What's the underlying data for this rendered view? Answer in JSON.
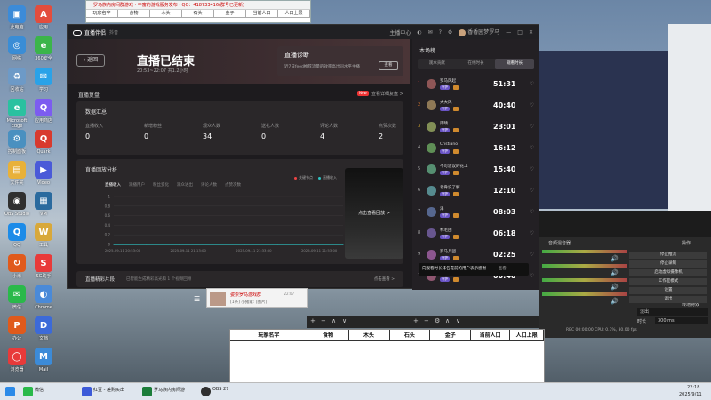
{
  "top_sheet": {
    "title": "罗马族内房间群游戏 · 丰富的游戏服务发布 · QQ：418733416(群号已更新)",
    "cols": [
      "玩家名字",
      "食物",
      "木头",
      "石头",
      "金子",
      "当前人口",
      "人口上限"
    ]
  },
  "desktop_icons": [
    {
      "label": "此电脑",
      "color": "#3c8bd8",
      "glyph": "▣"
    },
    {
      "label": "应用",
      "color": "#e34d3d",
      "glyph": "A"
    },
    {
      "label": "网络",
      "color": "#3a8dd6",
      "glyph": "◎"
    },
    {
      "label": "360安全",
      "color": "#3bb54a",
      "glyph": "e"
    },
    {
      "label": "回收站",
      "color": "#6d9ac7",
      "glyph": "♻"
    },
    {
      "label": "学习",
      "color": "#2aa2e8",
      "glyph": "✉"
    },
    {
      "label": "Microsoft Edge",
      "color": "#2ac1a0",
      "glyph": "e"
    },
    {
      "label": "应用商店",
      "color": "#7c5cf0",
      "glyph": "Q"
    },
    {
      "label": "控制面板",
      "color": "#4a90c0",
      "glyph": "⚙"
    },
    {
      "label": "Quark",
      "color": "#d83a2e",
      "glyph": "Q"
    },
    {
      "label": "文件夹",
      "color": "#e8b13a",
      "glyph": "▤"
    },
    {
      "label": "Video",
      "color": "#4a5ad8",
      "glyph": "▶"
    },
    {
      "label": "OBS Studio",
      "color": "#303030",
      "glyph": "◉"
    },
    {
      "label": "VM",
      "color": "#2a6a9e",
      "glyph": "▦"
    },
    {
      "label": "QQ",
      "color": "#1c8be8",
      "glyph": "Q"
    },
    {
      "label": "工具",
      "color": "#d8a83a",
      "glyph": "W"
    },
    {
      "label": "小米",
      "color": "#e05a1c",
      "glyph": "↻"
    },
    {
      "label": "SG助手",
      "color": "#e83a3a",
      "glyph": "S"
    },
    {
      "label": "微信",
      "color": "#2ab94a",
      "glyph": "✉"
    },
    {
      "label": "Chrome",
      "color": "#4a8ad8",
      "glyph": "◐"
    },
    {
      "label": "办公",
      "color": "#e05a1c",
      "glyph": "P"
    },
    {
      "label": "文档",
      "color": "#3c6ad8",
      "glyph": "D"
    },
    {
      "label": "浏览器",
      "color": "#e83a3a",
      "glyph": "◯"
    },
    {
      "label": "Mail",
      "color": "#3c8bd8",
      "glyph": "M"
    }
  ],
  "app": {
    "logo": "直播伴侣",
    "sub": "抖音",
    "topbar": [
      "主播中心",
      "客服",
      "帮助",
      "设置"
    ],
    "user": "香香园梦罗马",
    "back": "返回",
    "title": "直播已结束",
    "timeinfo": "20:53~22:07 共1.2小时",
    "diagnosis": {
      "title": "直播诊断",
      "desc": "近7日feed推荐流量的效率高出同水平主播",
      "button": "查看"
    },
    "review_title": "直播复盘",
    "new_badge": "New",
    "review_link": "查看详细复盘 >",
    "summary": {
      "title": "数据汇总",
      "stats": [
        {
          "label": "直播收入",
          "value": "0"
        },
        {
          "label": "新增粉丝",
          "value": "0"
        },
        {
          "label": "观众人数",
          "value": "34"
        },
        {
          "label": "送礼人数",
          "value": "0"
        },
        {
          "label": "评论人数",
          "value": "4"
        },
        {
          "label": "点赞次数",
          "value": "2"
        }
      ]
    },
    "trend": {
      "title": "直播回放分析",
      "tabs": [
        "直播收入",
        "观播用户",
        "粉丝变化",
        "观众进出",
        "评论人数",
        "点赞次数"
      ],
      "legend": [
        "关键节点",
        "直播收入"
      ],
      "replay": "点击查看回放 >"
    },
    "clips": {
      "title": "直播精彩片段",
      "desc": "已智能生成精彩高光和 1 个视频回顾",
      "link": "点击查看 >"
    },
    "ranking": {
      "title": "本场榜",
      "tabs": [
        "观众贡献",
        "在线时长",
        "观看时长"
      ],
      "rows": [
        {
          "rank": "1",
          "name": "罗马风起",
          "badge": "守护",
          "time": "51:31"
        },
        {
          "rank": "2",
          "name": "天天风",
          "badge": "守护",
          "time": "40:40"
        },
        {
          "rank": "3",
          "name": "雨晴",
          "badge": "守护",
          "time": "23:01"
        },
        {
          "rank": "4",
          "name": "Cristiano",
          "badge": "守护",
          "time": "16:12"
        },
        {
          "rank": "5",
          "name": "不可思议的花工",
          "badge": "守护",
          "time": "15:40"
        },
        {
          "rank": "6",
          "name": "老骨说了解",
          "badge": "守护",
          "time": "12:10"
        },
        {
          "rank": "7",
          "name": "泽",
          "badge": "守护",
          "time": "08:03"
        },
        {
          "rank": "8",
          "name": "林毛团",
          "badge": "守护",
          "time": "06:18"
        },
        {
          "rank": "9",
          "name": "罗马兵团",
          "badge": "守护",
          "time": "02:25"
        },
        {
          "rank": "10",
          "name": "路路 城堡",
          "badge": "守护",
          "time": "00:40"
        }
      ]
    },
    "tooltip": "向观看时长排名靠前的用户表示感谢~",
    "tooltip_btn": "查看"
  },
  "chart_data": {
    "type": "line",
    "x": [
      "2025-09-11 20:53:00",
      "2025-09-11 21:03:00",
      "2025-09-11 21:13:00",
      "2025-09-11 21:23:00",
      "2025-09-11 21:33:00",
      "2025-09-11 21:43:00",
      "2025-09-11 21:53:00",
      "2025-09-11 22:03:00"
    ],
    "series": [
      {
        "name": "直播收入",
        "values": [
          0,
          0,
          0,
          0,
          0,
          0,
          0,
          0
        ]
      }
    ],
    "x_tick_labels": [
      "2025-09-11 20:53:00",
      "2025-09-11 21:13:00",
      "2025-09-11 21:33:00",
      "2025-09-11 21:53:00"
    ],
    "y_tick_labels": [
      "1",
      "0.8",
      "0.6",
      "0.4",
      "0.2",
      "0"
    ],
    "ylim": [
      0,
      1
    ],
    "grid": true
  },
  "obs": {
    "record": "停止推流",
    "controls": [
      "停止录制",
      "启动虚拟摄像机",
      "工作室模式",
      "设置",
      "退出"
    ],
    "panel_title": "操作",
    "mixer_title": "音频混音器",
    "transition_title": "转场特效",
    "transition_value": "淡出",
    "duration_label": "时长",
    "duration_value": "300 ms",
    "status": "REC 00:00:00   CPU: 0.3%, 30.00 fps"
  },
  "chat": {
    "name": "姿崇罗马游戏群",
    "msg": "[1条] 小猪家: [图片]",
    "time": "22:07"
  },
  "sheet": {
    "cols": [
      "玩家名字",
      "食物",
      "木头",
      "石头",
      "金子",
      "当前人口",
      "人口上限"
    ]
  },
  "taskbar": {
    "items": [
      "微信",
      "红豆 - 差购买出",
      "罗马族内房间游",
      "OBS 27"
    ],
    "time": "22:18",
    "date": "2025/9/11"
  }
}
